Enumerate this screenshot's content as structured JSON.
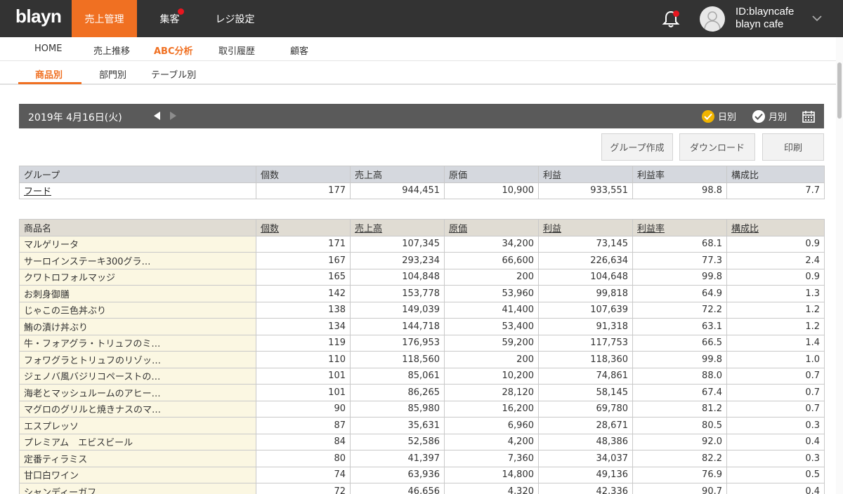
{
  "app": {
    "logo": "blayn"
  },
  "topnav": {
    "items": [
      {
        "label": "売上管理",
        "active": true
      },
      {
        "label": "集客",
        "badge": true
      },
      {
        "label": "レジ設定"
      }
    ]
  },
  "account": {
    "id": "ID:blayncafe",
    "name": "blayn cafe"
  },
  "subnav1": {
    "items": [
      "HOME",
      "売上推移",
      "ABC分析",
      "取引履歴",
      "顧客"
    ],
    "active_index": 2
  },
  "subnav2": {
    "items": [
      "商品別",
      "部門別",
      "テーブル別"
    ],
    "active_index": 0
  },
  "datebar": {
    "date": "2019年 4月16日(火)",
    "daily_label": "日別",
    "monthly_label": "月別",
    "selected": "daily"
  },
  "buttons": {
    "group_create": "グループ作成",
    "download": "ダウンロード",
    "print": "印刷"
  },
  "group_table": {
    "headers": [
      "グループ",
      "個数",
      "売上高",
      "原価",
      "利益",
      "利益率",
      "構成比"
    ],
    "rows": [
      [
        "フード",
        "177",
        "944,451",
        "10,900",
        "933,551",
        "98.8",
        "7.7"
      ]
    ]
  },
  "product_table": {
    "headers": [
      "商品名",
      "個数",
      "売上高",
      "原価",
      "利益",
      "利益率",
      "構成比"
    ],
    "rows": [
      [
        "マルゲリータ",
        "171",
        "107,345",
        "34,200",
        "73,145",
        "68.1",
        "0.9"
      ],
      [
        "サーロインステーキ300グラ…",
        "167",
        "293,234",
        "66,600",
        "226,634",
        "77.3",
        "2.4"
      ],
      [
        "クワトロフォルマッジ",
        "165",
        "104,848",
        "200",
        "104,648",
        "99.8",
        "0.9"
      ],
      [
        "お刺身御膳",
        "142",
        "153,778",
        "53,960",
        "99,818",
        "64.9",
        "1.3"
      ],
      [
        "じゃこの三色丼ぶり",
        "138",
        "149,039",
        "41,400",
        "107,639",
        "72.2",
        "1.2"
      ],
      [
        "鮪の漬け丼ぶり",
        "134",
        "144,718",
        "53,400",
        "91,318",
        "63.1",
        "1.2"
      ],
      [
        "牛・フォアグラ・トリュフのミ…",
        "119",
        "176,953",
        "59,200",
        "117,753",
        "66.5",
        "1.4"
      ],
      [
        "フォワグラとトリュフのリゾッ…",
        "110",
        "118,560",
        "200",
        "118,360",
        "99.8",
        "1.0"
      ],
      [
        "ジェノバ風バジリコペーストの…",
        "101",
        "85,061",
        "10,200",
        "74,861",
        "88.0",
        "0.7"
      ],
      [
        "海老とマッシュルームのアヒー…",
        "101",
        "86,265",
        "28,120",
        "58,145",
        "67.4",
        "0.7"
      ],
      [
        "マグロのグリルと焼きナスのマ…",
        "90",
        "85,980",
        "16,200",
        "69,780",
        "81.2",
        "0.7"
      ],
      [
        "エスプレッソ",
        "87",
        "35,631",
        "6,960",
        "28,671",
        "80.5",
        "0.3"
      ],
      [
        "プレミアム　エビスビール",
        "84",
        "52,586",
        "4,200",
        "48,386",
        "92.0",
        "0.4"
      ],
      [
        "定番ティラミス",
        "80",
        "41,397",
        "7,360",
        "34,037",
        "82.2",
        "0.3"
      ],
      [
        "甘口白ワイン",
        "74",
        "63,936",
        "14,800",
        "49,136",
        "76.9",
        "0.5"
      ],
      [
        "シャンディーガフ",
        "72",
        "46,656",
        "4,320",
        "42,336",
        "90.7",
        "0.4"
      ]
    ]
  },
  "colors": {
    "accent": "#f07022",
    "topbar": "#333333",
    "datebar": "#5a5a5a",
    "badge": "#e8161f"
  },
  "icons": [
    "bell-icon",
    "user-avatar-icon",
    "chevron-down-icon",
    "caret-left-icon",
    "caret-right-icon",
    "check-circle-icon",
    "calendar-icon"
  ]
}
